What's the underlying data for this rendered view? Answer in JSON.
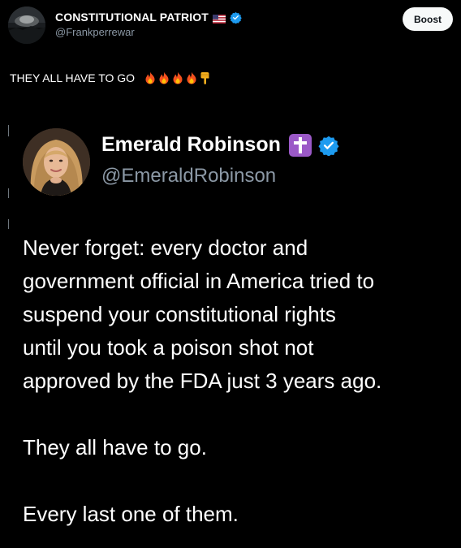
{
  "post": {
    "author_name": "CONSTITUTIONAL PATRIOT",
    "author_handle": "@Frankperrewar",
    "boost_label": "Boost",
    "text": "THEY ALL HAVE TO GO",
    "emojis": [
      "fire-icon",
      "fire-icon",
      "fire-icon",
      "fire-icon",
      "pointing-down-icon"
    ],
    "flag_icon": "us-flag-icon",
    "verified_icon": "verified-badge-icon"
  },
  "quote": {
    "author_name": "Emerald Robinson",
    "author_handle": "@EmeraldRobinson",
    "badge_icon": "latin-cross-icon",
    "verified_icon": "verified-badge-icon",
    "paragraphs": [
      {
        "lines": [
          "Never forget: every doctor and",
          "government official in America tried to",
          "suspend your constitutional rights",
          "until you took a poison shot not",
          "approved by the FDA just 3 years ago."
        ]
      },
      {
        "lines": [
          "They all have to go."
        ]
      },
      {
        "lines": [
          "Every last one of them."
        ]
      }
    ]
  },
  "colors": {
    "background": "#000000",
    "text": "#ffffff",
    "secondary_text": "#8b98a5",
    "verified_blue": "#1d9bf0",
    "boost_button_bg": "#f7f9f9",
    "cross_badge": "#9b59c7"
  }
}
